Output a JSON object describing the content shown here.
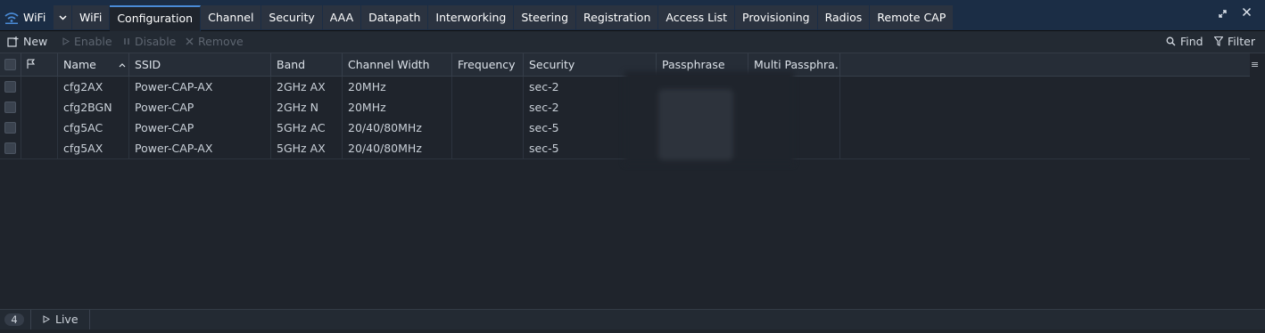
{
  "app": {
    "title": "WiFi"
  },
  "tabs": [
    {
      "label": "WiFi",
      "active": false
    },
    {
      "label": "Configuration",
      "active": true
    },
    {
      "label": "Channel",
      "active": false
    },
    {
      "label": "Security",
      "active": false
    },
    {
      "label": "AAA",
      "active": false
    },
    {
      "label": "Datapath",
      "active": false
    },
    {
      "label": "Interworking",
      "active": false
    },
    {
      "label": "Steering",
      "active": false
    },
    {
      "label": "Registration",
      "active": false
    },
    {
      "label": "Access List",
      "active": false
    },
    {
      "label": "Provisioning",
      "active": false
    },
    {
      "label": "Radios",
      "active": false
    },
    {
      "label": "Remote CAP",
      "active": false
    }
  ],
  "toolbar": {
    "new_label": "New",
    "enable_label": "Enable",
    "disable_label": "Disable",
    "remove_label": "Remove",
    "find_label": "Find",
    "filter_label": "Filter"
  },
  "table": {
    "columns": [
      "Name",
      "SSID",
      "Band",
      "Channel Width",
      "Frequency",
      "Security",
      "Passphrase",
      "Multi Passphra..."
    ],
    "rows": [
      {
        "name": "cfg2AX",
        "ssid": "Power-CAP-AX",
        "band": "2GHz AX",
        "channel_width": "20MHz",
        "frequency": "",
        "security": "sec-2"
      },
      {
        "name": "cfg2BGN",
        "ssid": "Power-CAP",
        "band": "2GHz N",
        "channel_width": "20MHz",
        "frequency": "",
        "security": "sec-2"
      },
      {
        "name": "cfg5AC",
        "ssid": "Power-CAP",
        "band": "5GHz AC",
        "channel_width": "20/40/80MHz",
        "frequency": "",
        "security": "sec-5"
      },
      {
        "name": "cfg5AX",
        "ssid": "Power-CAP-AX",
        "band": "5GHz AX",
        "channel_width": "20/40/80MHz",
        "frequency": "",
        "security": "sec-5"
      }
    ]
  },
  "status": {
    "count": "4",
    "live_label": "Live"
  },
  "colors": {
    "accent": "#4a8bd6",
    "background": "#1f242c",
    "titlebar": "#1b2d45"
  }
}
